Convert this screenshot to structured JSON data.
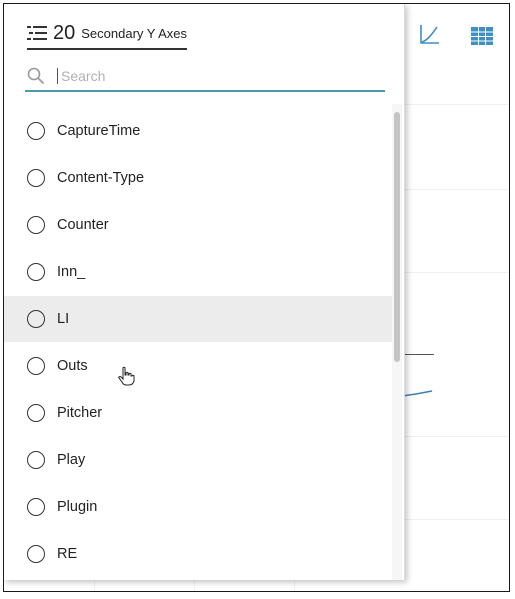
{
  "header": {
    "count": "20",
    "title": "Secondary Y Axes",
    "icon": "list-icon"
  },
  "search": {
    "placeholder": "Search",
    "value": "",
    "icon": "search-icon"
  },
  "list": {
    "items": [
      {
        "label": "CaptureTime",
        "selected": false
      },
      {
        "label": "Content-Type",
        "selected": false
      },
      {
        "label": "Counter",
        "selected": false
      },
      {
        "label": "Inn_",
        "selected": false
      },
      {
        "label": "LI",
        "selected": false,
        "hovered": true
      },
      {
        "label": "Outs",
        "selected": false
      },
      {
        "label": "Pitcher",
        "selected": false
      },
      {
        "label": "Play",
        "selected": false
      },
      {
        "label": "Plugin",
        "selected": false
      },
      {
        "label": "RE",
        "selected": false
      }
    ]
  },
  "toolbar": {
    "icons": [
      "line-chart-icon",
      "table-icon"
    ]
  },
  "colors": {
    "accent": "#4a9aa8",
    "toolbar_icon": "#3d8fc4",
    "series": "#3a7fb5"
  }
}
